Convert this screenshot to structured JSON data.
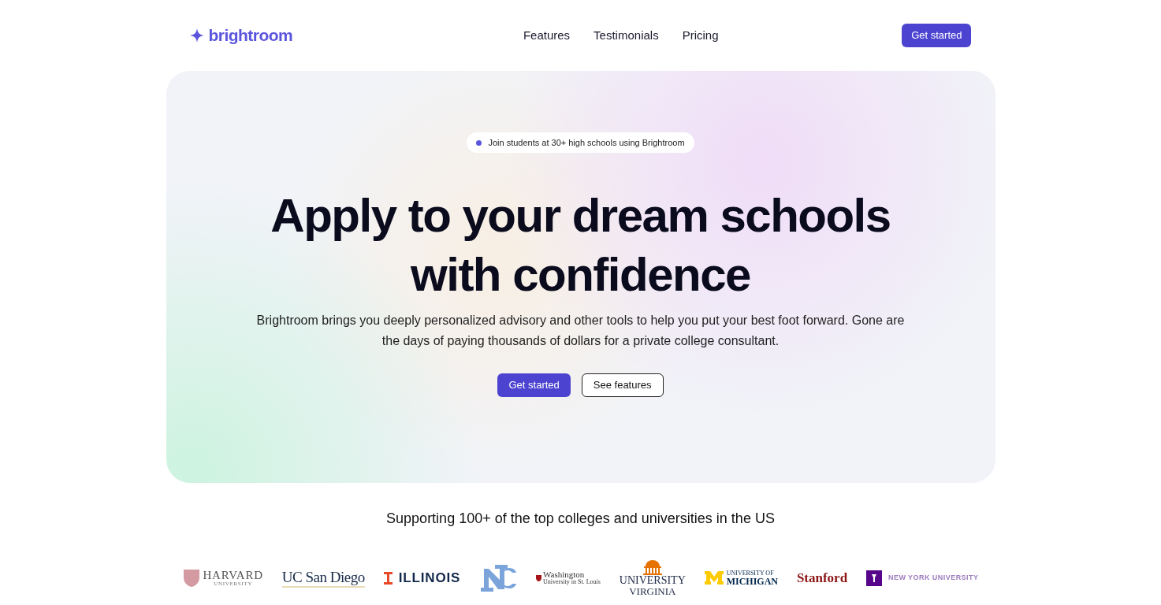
{
  "header": {
    "brand": "brightroom",
    "nav": [
      "Features",
      "Testimonials",
      "Pricing"
    ],
    "cta": "Get started"
  },
  "hero": {
    "badge": "Join students at 30+ high schools using Brightroom",
    "title_lines": [
      "Apply to your dream schools",
      "with confidence"
    ],
    "description": "Brightroom brings you deeply personalized advisory and other tools to help you put your best foot forward. Gone are the days of paying thousands of dollars for a private college consultant.",
    "primary_button": "Get started",
    "secondary_button": "See features"
  },
  "logos_heading": "Supporting 100+ of the top colleges and universities in the US",
  "logos": [
    {
      "kind": "crest",
      "lines": [
        "HARVARD",
        "UNIVERSITY"
      ],
      "color": "#d49aa2"
    },
    {
      "kind": "underline",
      "lines": [
        "UC San Diego"
      ],
      "color": "#182b49"
    },
    {
      "kind": "block-i",
      "lines": [
        "ILLINOIS"
      ],
      "color": "#e84a27"
    },
    {
      "kind": "monogram",
      "color": "#7ba4db"
    },
    {
      "kind": "small-crest",
      "lines": [
        "Washington",
        "University in St. Louis"
      ],
      "color": "#a51417"
    },
    {
      "kind": "dome",
      "lines": [
        "UNIVERSITY",
        "VIRGINIA"
      ],
      "color": "#e57200"
    },
    {
      "kind": "block-m",
      "lines": [
        "UNIVERSITY OF",
        "MICHIGAN"
      ],
      "color": "#ffcb05"
    },
    {
      "kind": "wordmark",
      "lines": [
        "Stanford"
      ],
      "color": "#8c1515"
    },
    {
      "kind": "torch",
      "lines": [
        "NEW YORK UNIVERSITY"
      ],
      "color": "#57068c"
    }
  ]
}
